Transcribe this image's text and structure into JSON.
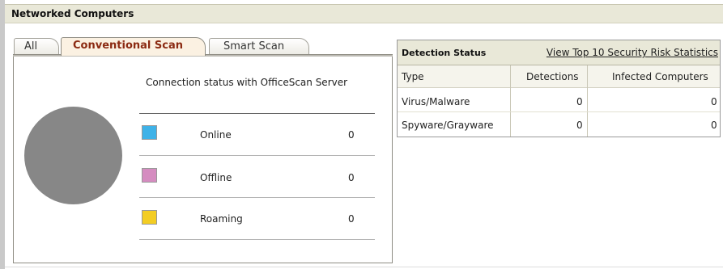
{
  "panel": {
    "title": "Networked Computers"
  },
  "tabs": [
    {
      "label": "All",
      "active": false
    },
    {
      "label": "Conventional Scan",
      "active": true
    },
    {
      "label": "Smart Scan",
      "active": false
    }
  ],
  "connection": {
    "title": "Connection status with OfficeScan Server",
    "statuses": [
      {
        "label": "Online",
        "count": "0",
        "color": "#3eb2e8"
      },
      {
        "label": "Offline",
        "count": "0",
        "color": "#d58cc0"
      },
      {
        "label": "Roaming",
        "count": "0",
        "color": "#f3cd23"
      }
    ],
    "chart_color": "#878787"
  },
  "detection": {
    "title": "Detection Status",
    "link": "View Top 10 Security Risk Statistics",
    "columns": [
      "Type",
      "Detections",
      "Infected Computers"
    ],
    "rows": [
      {
        "type": "Virus/Malware",
        "detections": "0",
        "infected": "0"
      },
      {
        "type": "Spyware/Grayware",
        "detections": "0",
        "infected": "0"
      }
    ]
  },
  "colors": {
    "header_bg": "#e9e8d8",
    "active_tab_text": "#8b2a12",
    "active_tab_bg": "#fbf1e2"
  }
}
